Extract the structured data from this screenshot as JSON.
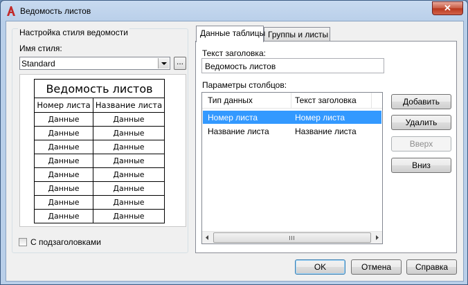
{
  "window": {
    "title": "Ведомость листов",
    "close_glyph": "✕",
    "icon": "autocad-a-icon",
    "accent_color": "#c22a2a"
  },
  "left_panel": {
    "group_title": "Настройка стиля ведомости",
    "style_name_label": "Имя стиля:",
    "style_value": "Standard",
    "ellipsis_label": "...",
    "preview": {
      "title": "Ведомость листов",
      "headers": [
        "Номер листа",
        "Название листа"
      ],
      "rows": [
        [
          "Данные",
          "Данные"
        ],
        [
          "Данные",
          "Данные"
        ],
        [
          "Данные",
          "Данные"
        ],
        [
          "Данные",
          "Данные"
        ],
        [
          "Данные",
          "Данные"
        ],
        [
          "Данные",
          "Данные"
        ],
        [
          "Данные",
          "Данные"
        ],
        [
          "Данные",
          "Данные"
        ]
      ]
    },
    "subheadings_checkbox_label": "С подзаголовками",
    "subheadings_checked": false
  },
  "tabs": [
    {
      "label": "Данные таблицы",
      "active": true
    },
    {
      "label": "Группы и листы",
      "active": false
    }
  ],
  "table_data": {
    "header_text_label": "Текст заголовка:",
    "header_text_value": "Ведомость листов",
    "columns_label": "Параметры столбцов:",
    "list_headers": [
      "Тип данных",
      "Текст заголовка"
    ],
    "list_rows": [
      {
        "type": "Номер листа",
        "header": "Номер листа",
        "selected": true
      },
      {
        "type": "Название листа",
        "header": "Название листа",
        "selected": false
      }
    ],
    "buttons": {
      "add": "Добавить",
      "delete": "Удалить",
      "up": "Вверх",
      "down": "Вниз"
    }
  },
  "footer": {
    "ok": "OK",
    "cancel": "Отмена",
    "help": "Справка"
  }
}
